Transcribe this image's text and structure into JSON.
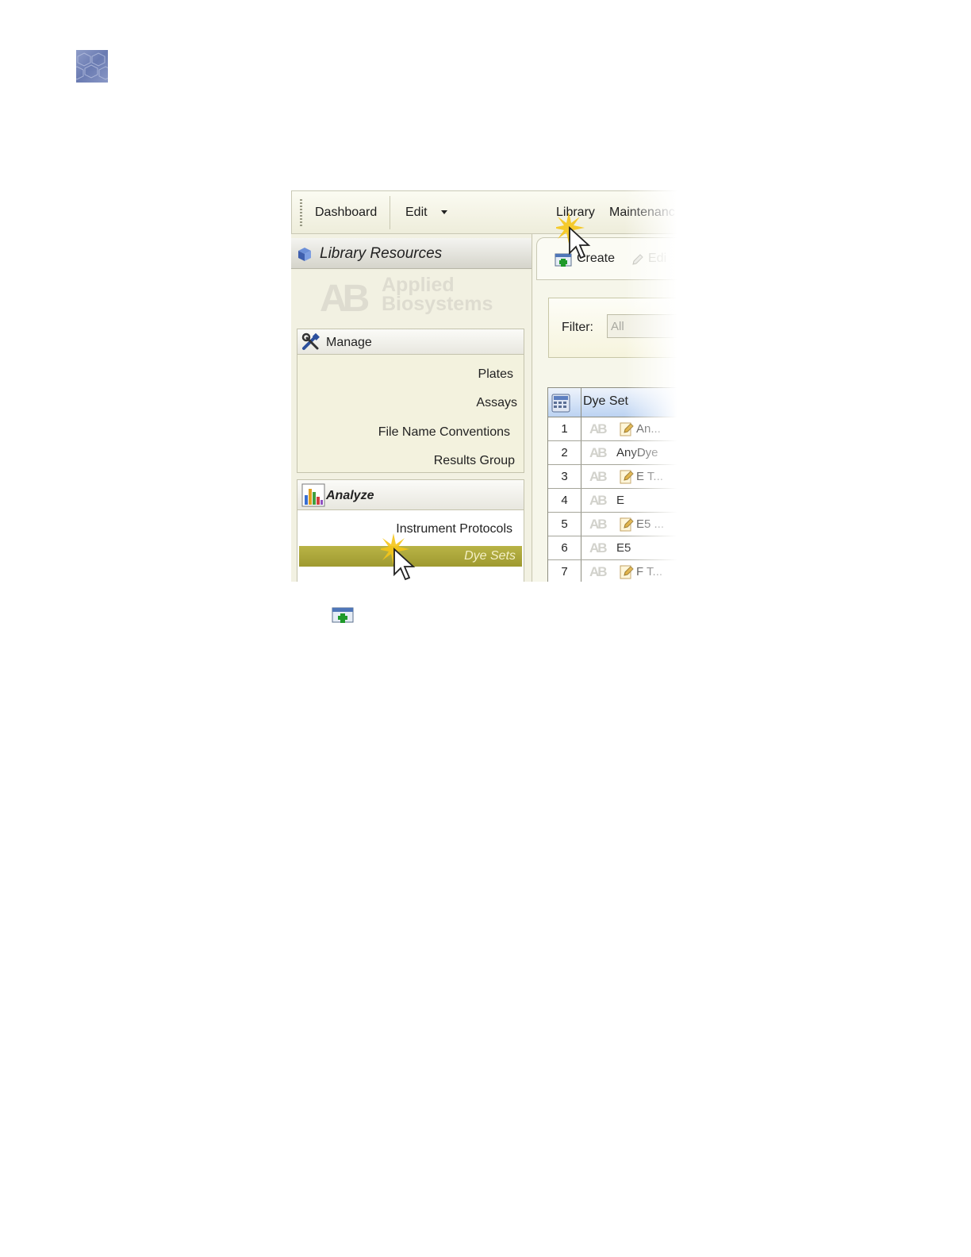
{
  "toolbar": {
    "dashboard": "Dashboard",
    "edit": "Edit",
    "library": "Library",
    "maintenance": "Maintenanc"
  },
  "left_panel": {
    "title": "Library Resources",
    "brand": {
      "mark": "AB",
      "line1": "Applied",
      "line2": "Biosystems"
    },
    "manage": {
      "title": "Manage",
      "items": [
        "Plates",
        "Assays",
        "File Name Conventions",
        "Results Group"
      ]
    },
    "analyze": {
      "title": "Analyze",
      "items": [
        "Instrument Protocols"
      ],
      "selected": "Dye Sets"
    }
  },
  "right_panel": {
    "create": "Create",
    "edit": "Edi",
    "filter_label": "Filter:",
    "filter_value": "All",
    "column": "Dye Set",
    "rows": [
      {
        "num": "1",
        "locked": true,
        "name": "An..."
      },
      {
        "num": "2",
        "locked": false,
        "name": "AnyDye"
      },
      {
        "num": "3",
        "locked": true,
        "name": "E T..."
      },
      {
        "num": "4",
        "locked": false,
        "name": "E"
      },
      {
        "num": "5",
        "locked": true,
        "name": "E5 ..."
      },
      {
        "num": "6",
        "locked": false,
        "name": "E5"
      },
      {
        "num": "7",
        "locked": true,
        "name": "F T..."
      }
    ]
  },
  "colors": {
    "selected_row": "#a9a438",
    "panel_bg": "#f2f1e2",
    "grid_header": "#bcd3f2"
  }
}
